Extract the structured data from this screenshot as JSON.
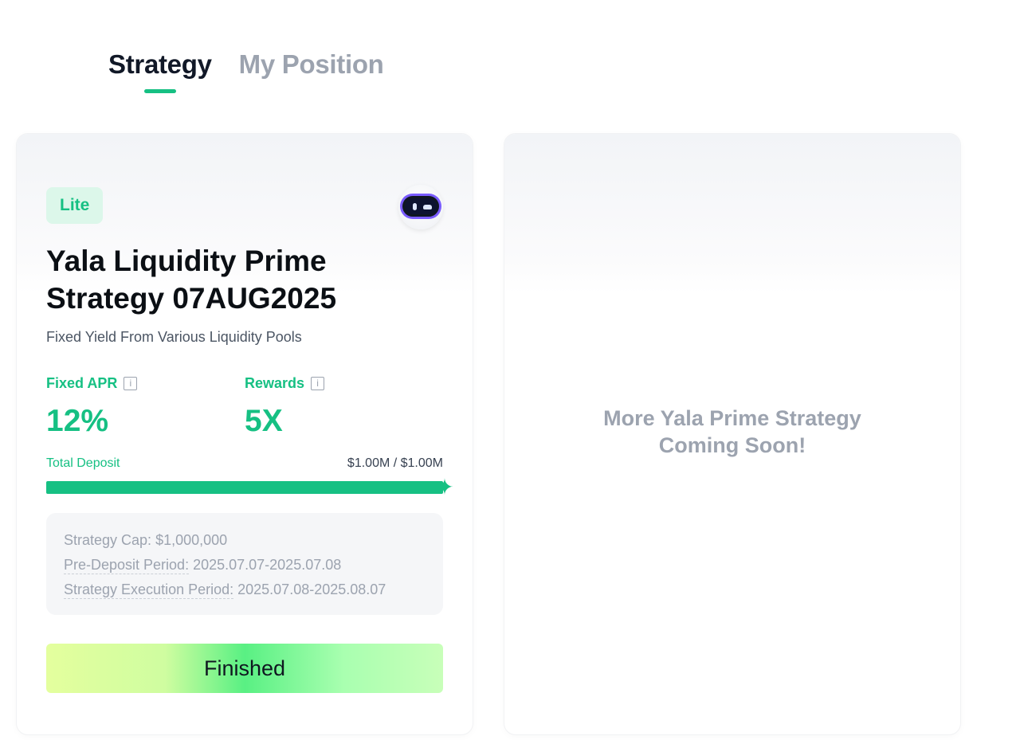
{
  "tabs": [
    {
      "label": "Strategy",
      "active": true
    },
    {
      "label": "My Position",
      "active": false
    }
  ],
  "colors": {
    "accent": "#16c083",
    "muted": "#9ca3af"
  },
  "strategy_card": {
    "badge": "Lite",
    "logo_icon": "robot-icon",
    "title": "Yala Liquidity Prime Strategy 07AUG2025",
    "subtitle": "Fixed Yield From Various Liquidity Pools",
    "metrics": [
      {
        "label": "Fixed APR",
        "value": "12%",
        "icon": "info-icon"
      },
      {
        "label": "Rewards",
        "value": "5X",
        "icon": "info-icon"
      }
    ],
    "deposit": {
      "label": "Total Deposit",
      "value": "$1.00M / $1.00M",
      "progress": 1.0
    },
    "details": [
      {
        "key": "Strategy Cap: ",
        "value": "$1,000,000",
        "underlined": false
      },
      {
        "key": "Pre-Deposit Period:",
        "value": " 2025.07.07-2025.07.08",
        "underlined": true
      },
      {
        "key": "Strategy Execution Period:",
        "value": " 2025.07.08-2025.08.07",
        "underlined": true
      }
    ],
    "button_label": "Finished"
  },
  "placeholder_card": {
    "line1": "More Yala Prime Strategy",
    "line2": "Coming Soon!"
  }
}
